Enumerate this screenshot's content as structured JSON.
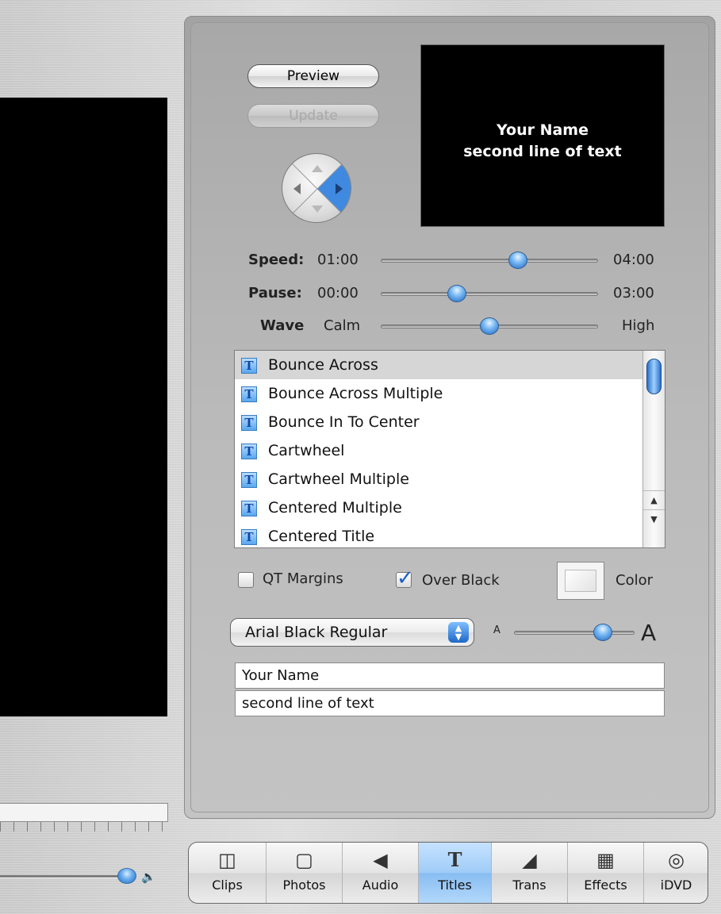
{
  "preview": {
    "preview_button": "Preview",
    "update_button": "Update",
    "screen_line1": "Your Name",
    "screen_line2": "second line of text"
  },
  "sliders": {
    "speed": {
      "label": "Speed:",
      "min": "01:00",
      "max": "04:00",
      "position": 0.63
    },
    "pause": {
      "label": "Pause:",
      "min": "00:00",
      "max": "03:00",
      "position": 0.35
    },
    "wave": {
      "label": "Wave",
      "min": "Calm",
      "max": "High",
      "position": 0.5
    }
  },
  "title_list": {
    "items": [
      {
        "label": "Bounce Across",
        "selected": true
      },
      {
        "label": "Bounce Across Multiple"
      },
      {
        "label": "Bounce In To Center"
      },
      {
        "label": "Cartwheel"
      },
      {
        "label": "Cartwheel Multiple"
      },
      {
        "label": "Centered Multiple"
      },
      {
        "label": "Centered Title"
      }
    ],
    "icon_letter": "T"
  },
  "options": {
    "qt_margins": {
      "label": "QT Margins",
      "checked": false
    },
    "over_black": {
      "label": "Over Black",
      "checked": true
    },
    "color_label": "Color"
  },
  "font": {
    "selected": "Arial Black Regular",
    "size_small": "A",
    "size_large": "A",
    "size_position": 0.74
  },
  "text_fields": {
    "line1": "Your Name",
    "line2": "second line of text"
  },
  "toolbar": {
    "items": [
      {
        "label": "Clips",
        "icon": "clips-icon"
      },
      {
        "label": "Photos",
        "icon": "photos-icon"
      },
      {
        "label": "Audio",
        "icon": "audio-icon"
      },
      {
        "label": "Titles",
        "icon": "titles-icon",
        "active": true
      },
      {
        "label": "Trans",
        "icon": "trans-icon"
      },
      {
        "label": "Effects",
        "icon": "effects-icon"
      },
      {
        "label": "iDVD",
        "icon": "idvd-icon"
      }
    ]
  }
}
